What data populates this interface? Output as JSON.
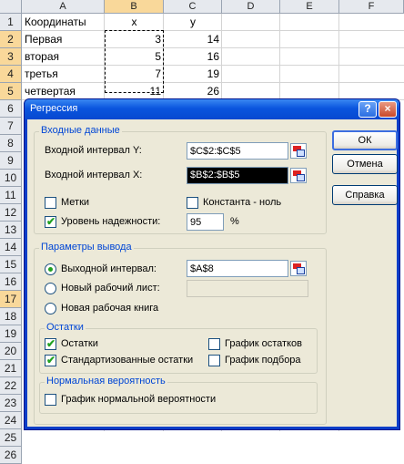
{
  "sheet": {
    "columns": [
      "A",
      "B",
      "C",
      "D",
      "E",
      "F"
    ],
    "rows": [
      "1",
      "2",
      "3",
      "4",
      "5",
      "6",
      "7",
      "8",
      "9",
      "10",
      "11",
      "12",
      "13",
      "14",
      "15",
      "16",
      "17",
      "18",
      "19",
      "20",
      "21",
      "22",
      "23",
      "24",
      "25",
      "26"
    ],
    "cells": {
      "A1": "Координаты",
      "B1": "x",
      "C1": "y",
      "A2": "Первая",
      "B2": "3",
      "C2": "14",
      "A3": "вторая",
      "B3": "5",
      "C3": "16",
      "A4": "третья",
      "B4": "7",
      "C4": "19",
      "A5": "четвертая",
      "B5": "11",
      "C5": "26"
    }
  },
  "dialog": {
    "title": "Регрессия",
    "close_symbol": "×",
    "help_symbol": "?",
    "input": {
      "group_label": "Входные данные",
      "y_label": "Входной интервал Y:",
      "y_value": "$C$2:$C$5",
      "x_label": "Входной интервал X:",
      "x_value": "$B$2:$B$5",
      "labels_label": "Метки",
      "constant_zero_label": "Константа - ноль",
      "confidence_label": "Уровень надежности:",
      "confidence_value": "95",
      "percent": "%"
    },
    "output": {
      "group_label": "Параметры вывода",
      "output_range_label": "Выходной интервал:",
      "output_range_value": "$A$8",
      "new_sheet_label": "Новый рабочий лист:",
      "new_workbook_label": "Новая рабочая книга",
      "selected": "output_range"
    },
    "residuals": {
      "group_label": "Остатки",
      "residuals_label": "Остатки",
      "standardized_label": "Стандартизованные остатки",
      "residual_plots_label": "График остатков",
      "line_fit_label": "График подбора"
    },
    "normal": {
      "group_label": "Нормальная вероятность",
      "plot_label": "График нормальной вероятности"
    },
    "buttons": {
      "ok": "ОК",
      "cancel": "Отмена",
      "help": "Справка"
    },
    "checked": {
      "labels": false,
      "constant_zero": false,
      "confidence": true,
      "residuals": true,
      "standardized": true,
      "residual_plots": false,
      "line_fit": false,
      "normal_plot": false
    },
    "check_mark": "✔"
  }
}
